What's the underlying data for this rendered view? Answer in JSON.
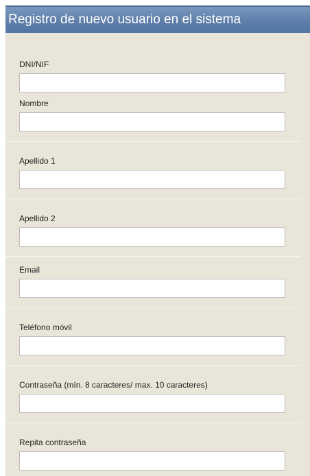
{
  "form": {
    "title": "Registro de nuevo usuario en el sistema",
    "fields": [
      {
        "label": "DNI/NIF",
        "value": ""
      },
      {
        "label": "Nombre",
        "value": ""
      },
      {
        "label": "Apellido 1",
        "value": ""
      },
      {
        "label": "Apellido 2",
        "value": ""
      },
      {
        "label": "Email",
        "value": ""
      },
      {
        "label": "Teléfono móvil",
        "value": ""
      },
      {
        "label": "Contraseña (mín. 8 caracteres/ max. 10 caracteres)",
        "value": ""
      },
      {
        "label": "Repita contraseña",
        "value": ""
      }
    ]
  },
  "colors": {
    "header_background": "#5f7faa",
    "header_text": "#ffffff",
    "panel_background": "#e9e6d9",
    "input_border": "#b9b9b9"
  }
}
